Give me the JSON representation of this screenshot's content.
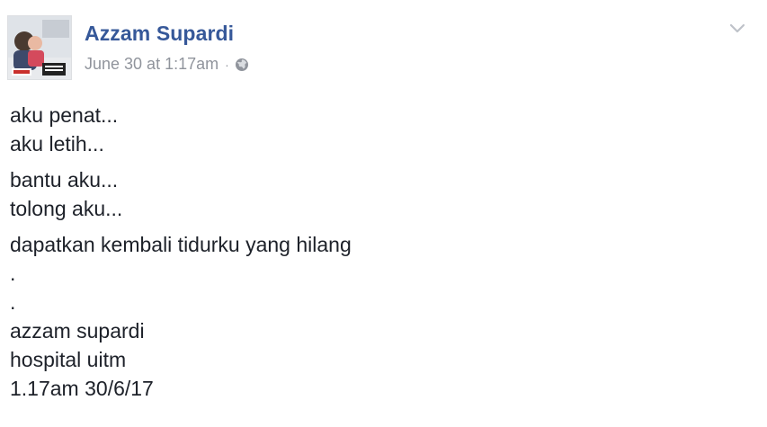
{
  "post": {
    "author": "Azzam Supardi",
    "timestamp": "June 30 at 1:17am",
    "separator": "·",
    "privacy_icon": "globe-icon",
    "menu_icon": "chevron-down-icon",
    "paragraphs": [
      [
        "aku penat...",
        "aku letih..."
      ],
      [
        "bantu aku...",
        "tolong aku..."
      ],
      [
        "dapatkan kembali tidurku yang hilang",
        ".",
        ".",
        "azzam supardi",
        "hospital uitm",
        "1.17am 30/6/17"
      ]
    ]
  },
  "colors": {
    "author_link": "#365899",
    "meta_text": "#90949c",
    "body_text": "#1d2129"
  }
}
